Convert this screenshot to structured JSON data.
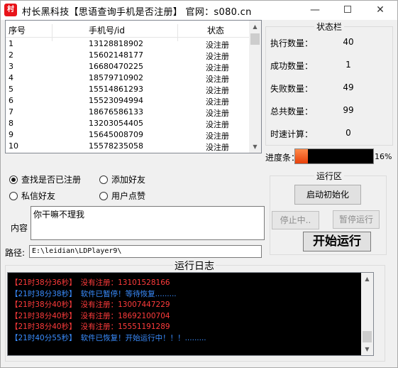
{
  "window": {
    "icon_text": "村",
    "title": "村长黑科技【思语查询手机是否注册】  官网：s080.cn",
    "minimize": "—",
    "close": "✕"
  },
  "table": {
    "headers": [
      "序号",
      "手机号/id",
      "状态"
    ],
    "rows": [
      [
        "1",
        "13128818902",
        "没注册"
      ],
      [
        "2",
        "15602148177",
        "没注册"
      ],
      [
        "3",
        "16680470225",
        "没注册"
      ],
      [
        "4",
        "18579710902",
        "没注册"
      ],
      [
        "5",
        "15514861293",
        "没注册"
      ],
      [
        "6",
        "15523094994",
        "没注册"
      ],
      [
        "7",
        "18676586133",
        "没注册"
      ],
      [
        "8",
        "13203054405",
        "没注册"
      ],
      [
        "9",
        "15645008709",
        "没注册"
      ],
      [
        "10",
        "15578235058",
        "没注册"
      ]
    ]
  },
  "status_panel": {
    "title": "状态栏",
    "items": [
      {
        "label": "执行数量：",
        "value": "40"
      },
      {
        "label": "成功数量：",
        "value": "1"
      },
      {
        "label": "失败数量：",
        "value": "49"
      },
      {
        "label": "总共数量：",
        "value": "99"
      },
      {
        "label": "时速计算：",
        "value": "0"
      }
    ],
    "progress_label": "进度条：",
    "progress_pct_text": "16%",
    "progress_fraction": 0.16
  },
  "options": {
    "radio_check_registered": "查找是否已注册",
    "radio_add_friend": "添加好友",
    "radio_private_friend": "私信好友",
    "radio_user_like": "用户点赞",
    "selected": "radio_check_registered"
  },
  "content": {
    "label": "内容",
    "value": "你干嘛不理我"
  },
  "path": {
    "label": "路径:",
    "value": "E:\\leidian\\LDPlayer9\\"
  },
  "run_area": {
    "title": "运行区",
    "init_button": "启动初始化",
    "stop_button": "停止中..",
    "pause_button": "暂停运行",
    "start_button": "开始运行"
  },
  "log": {
    "title": "运行日志",
    "lines": [
      {
        "time": "【21时38分36秒】",
        "text": "没有注册：13101528166",
        "color": "#ff3b3b"
      },
      {
        "time": "【21时38分38秒】",
        "text": "软件已暂停！等待恢复.........",
        "color": "#3a8dff"
      },
      {
        "time": "【21时38分40秒】",
        "text": "没有注册：13007447229",
        "color": "#ff3b3b"
      },
      {
        "time": "【21时38分40秒】",
        "text": "没有注册：18692100704",
        "color": "#ff3b3b"
      },
      {
        "time": "【21时38分40秒】",
        "text": "没有注册：15551191289",
        "color": "#ff3b3b"
      },
      {
        "time": "【21时40分55秒】",
        "text": "软件已恢复！开始运行中！！！.........",
        "color": "#3a8dff"
      }
    ]
  },
  "colors": {
    "log_error": "#ff3b3b",
    "log_info": "#3a8dff",
    "progress_fill": "#e8400a"
  }
}
